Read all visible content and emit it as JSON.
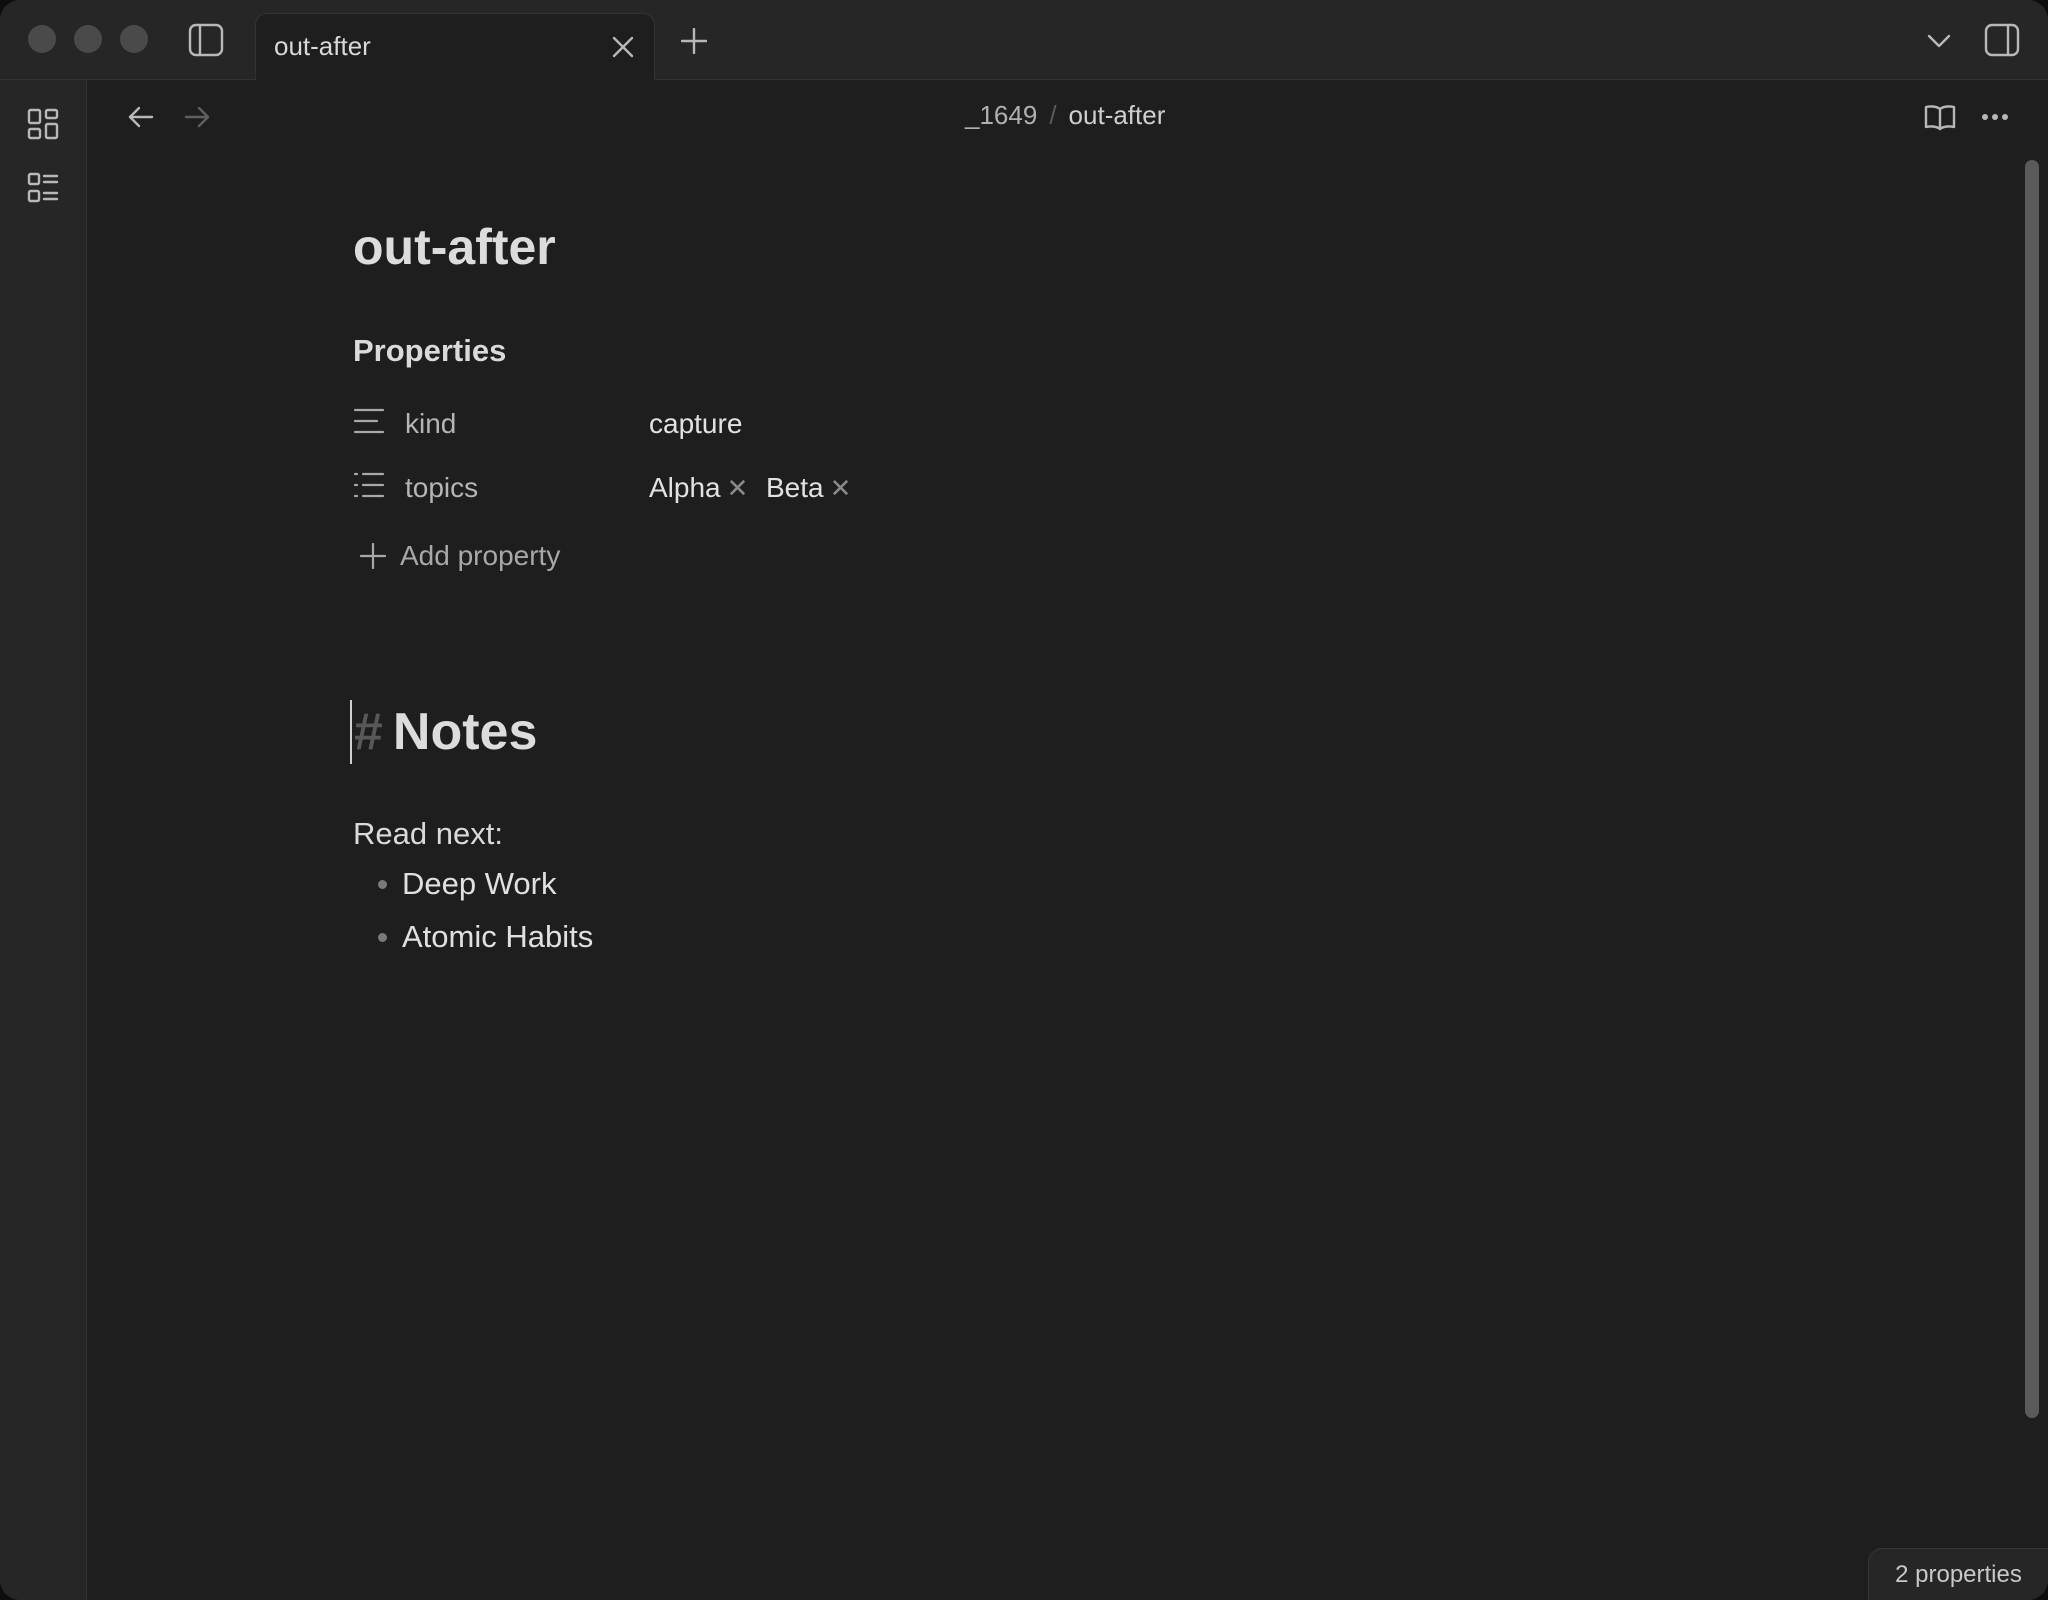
{
  "tab": {
    "title": "out-after"
  },
  "breadcrumb": {
    "folder": "_1649",
    "separator": "/",
    "current": "out-after"
  },
  "note": {
    "title": "out-after",
    "properties_heading": "Properties",
    "properties": [
      {
        "key": "kind",
        "icon": "text-lines-icon",
        "value": "capture"
      },
      {
        "key": "topics",
        "icon": "list-icon",
        "tags": [
          "Alpha",
          "Beta"
        ]
      }
    ],
    "add_property_label": "Add property",
    "heading_marker": "#",
    "heading": "Notes",
    "paragraph": "Read next:",
    "list_items": [
      "Deep Work",
      "Atomic Habits"
    ]
  },
  "status_bar": {
    "properties_count": "2 properties"
  },
  "glyphs": {
    "tag_remove": "✕"
  }
}
